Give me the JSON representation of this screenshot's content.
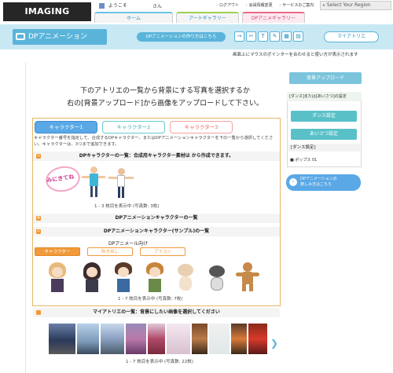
{
  "header": {
    "logo": "IMAGING SQUARE",
    "welcome": "ようこそ",
    "honorific": "さん",
    "links": [
      "ログアウト",
      "会員情報変更",
      "サービスのご案内"
    ],
    "region": "Select Your Region",
    "tabs": [
      "ホーム",
      "アートギャラリー",
      "DPアニメギャラリー"
    ]
  },
  "band": {
    "title": "DPアニメーション",
    "howto": "DPアニメーションの作り方はこちら",
    "tool_icons": [
      "→",
      "✂",
      "T",
      "✎",
      "▦",
      "▤"
    ],
    "my_atelier": "マイアトリエ",
    "hint": "画面上にマウスのポインターを合わせると使い方が表示されます"
  },
  "main": {
    "instruction_line1": "下のアトリエの一覧から背景にする写真を選択するか",
    "instruction_line2": "右の[背景アップロード]から画像をアップロードして下さい。",
    "char_tabs": [
      "キャラクター1",
      "キャラクター2",
      "キャラクター3"
    ],
    "char_desc": "キャラクター番号を指定して、合成するDPキャラクター、またはDPアニメーションキャラクターを下の一覧から選択してください。キャラクターは、3つまで追加できます。",
    "section1": "DPキャラクターの一覧：合成用キャラクター素材は  から作成できます。",
    "scribble": "みにきてね",
    "count1": "1 - 3 枚目を表示中 (写真数: 3枚)",
    "section2": "DPアニメーションキャラクターの一覧",
    "section3": "DPアニメーションキャラクター(サンプル)の一覧",
    "anim_sub": "DPアニメール向け",
    "sub_tabs": [
      "キャラクター",
      "吹き出し",
      "アイコン"
    ],
    "count2": "1 - 7 枚目を表示中 (写真数: 7枚)",
    "atelier_head": "マイアトリエの一覧：背景にしたい画像を選択してください",
    "count3": "1 - 7 枚目を表示中 (写真数: 22枚)"
  },
  "sidebar": {
    "bg_upload": "背景アップロード",
    "panel_head": "[ダンス]または[あいさつ]の設定",
    "dance_btn": "ダンス設定",
    "greet_btn": "あいさつ設定",
    "dance_label": "[ダンス設定]",
    "pose_label": "■:ポップス 01",
    "enjoy_line1": "DPアニメーションの",
    "enjoy_line2": "楽しみ方はこちら"
  },
  "colors": {
    "accent_blue": "#5ab4da",
    "band": "#c8e8f4",
    "orange": "#f29a3a",
    "teal": "#59c0c8"
  }
}
